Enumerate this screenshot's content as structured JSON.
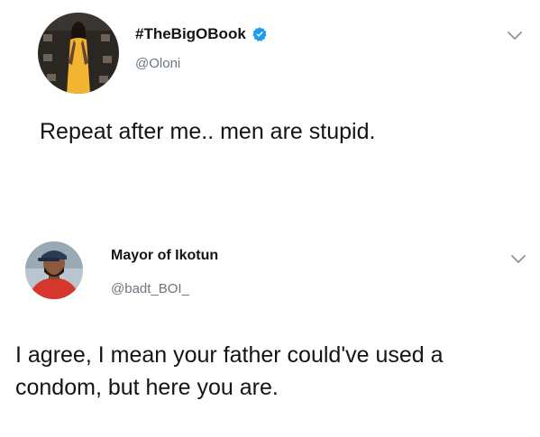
{
  "tweets": [
    {
      "display_name": "#TheBigOBook",
      "verified": true,
      "handle": "@Oloni",
      "text": "Repeat after me.. men are stupid.",
      "avatar_icon": "profile-photo-woman-yellow-dress",
      "menu_icon": "chevron-down-icon"
    },
    {
      "display_name": "Mayor of Ikotun",
      "verified": false,
      "handle": "@badt_BOI_",
      "text": "I agree, I mean your father could've used a condom, but here you are.",
      "avatar_icon": "profile-photo-man-cap",
      "menu_icon": "chevron-down-icon"
    }
  ],
  "colors": {
    "verified_badge": "#1d9bf0",
    "handle_gray": "#6b7680",
    "text": "#141414"
  }
}
